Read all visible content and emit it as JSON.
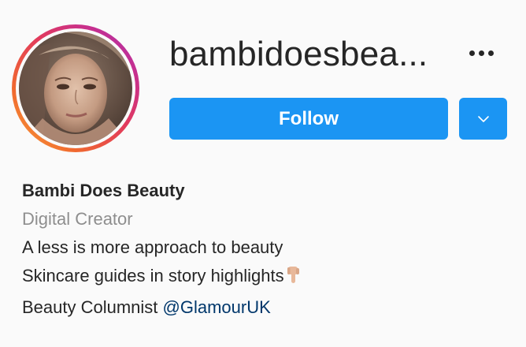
{
  "profile": {
    "username": "bambidoesbea...",
    "more_icon": "more-horizontal-icon",
    "follow_label": "Follow",
    "dropdown_icon": "chevron-down-icon",
    "accent_color": "#1b95f3"
  },
  "bio": {
    "full_name": "Bambi Does Beauty",
    "category": "Digital Creator",
    "lines": [
      "A less is more approach to beauty",
      "Skincare guides in story highlights",
      "Beauty Columnist "
    ],
    "emoji_icon": "pointing-down-hand-icon",
    "mention": "@GlamourUK"
  }
}
